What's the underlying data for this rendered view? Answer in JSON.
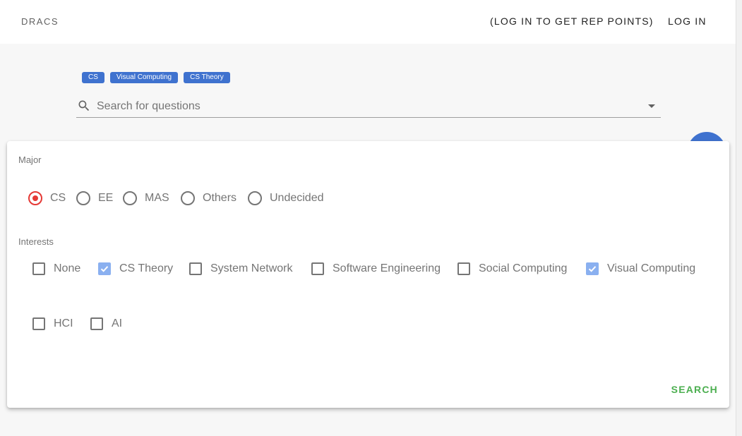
{
  "header": {
    "brand": "DRACS",
    "rep_label": "(LOG IN TO GET REP POINTS)",
    "login_label": "LOG IN"
  },
  "chips": [
    {
      "label": "CS"
    },
    {
      "label": "Visual Computing"
    },
    {
      "label": "CS Theory"
    }
  ],
  "search": {
    "placeholder": "Search for questions",
    "value": ""
  },
  "filter": {
    "major_label": "Major",
    "majors": [
      {
        "label": "CS",
        "selected": true
      },
      {
        "label": "EE",
        "selected": false
      },
      {
        "label": "MAS",
        "selected": false
      },
      {
        "label": "Others",
        "selected": false
      },
      {
        "label": "Undecided",
        "selected": false
      }
    ],
    "interests_label": "Interests",
    "interests": [
      {
        "label": "None",
        "checked": false
      },
      {
        "label": "CS Theory",
        "checked": true
      },
      {
        "label": "System Network",
        "checked": false
      },
      {
        "label": "Software Engineering",
        "checked": false
      },
      {
        "label": "Social Computing",
        "checked": false
      },
      {
        "label": "Visual Computing",
        "checked": true
      },
      {
        "label": "HCI",
        "checked": false
      },
      {
        "label": "AI",
        "checked": false
      }
    ],
    "search_label": "SEARCH"
  },
  "colors": {
    "chip": "#3f72cf",
    "radio_selected": "#e53935",
    "checkbox_checked": "#8ab0f0",
    "search_action": "#4caf50"
  }
}
